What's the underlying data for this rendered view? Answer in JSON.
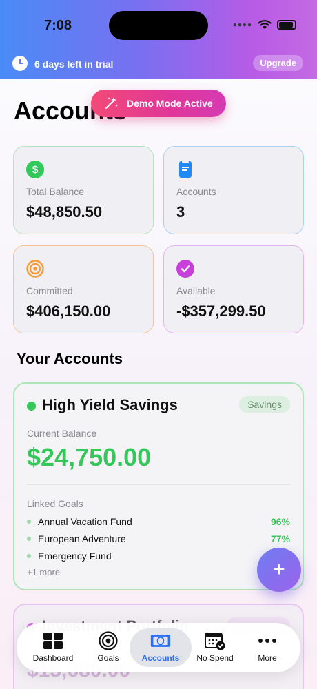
{
  "status_bar": {
    "time": "7:08"
  },
  "trial_banner": {
    "text": "6 days left in trial",
    "upgrade_label": "Upgrade"
  },
  "page": {
    "title": "Accounts",
    "demo_label": "Demo Mode Active"
  },
  "stats": [
    {
      "label": "Total Balance",
      "value": "$48,850.50",
      "icon": "dollar-icon",
      "color": "#34c759",
      "border": "#b6e5c0"
    },
    {
      "label": "Accounts",
      "value": "3",
      "icon": "card-icon",
      "color": "#1f8af5",
      "border": "#a7d3f5"
    },
    {
      "label": "Committed",
      "value": "$406,150.00",
      "icon": "target-icon",
      "color": "#f59b3a",
      "border": "#f4c49b"
    },
    {
      "label": "Available",
      "value": "-$357,299.50",
      "icon": "check-icon",
      "color": "#c53fd8",
      "border": "#e3b5ef"
    }
  ],
  "section": {
    "title": "Your Accounts"
  },
  "accounts": [
    {
      "name": "High Yield Savings",
      "type": "Savings",
      "balance_label": "Current Balance",
      "balance": "$24,750.00",
      "linked_goals_label": "Linked Goals",
      "goals": [
        {
          "name": "Annual Vacation Fund",
          "percent": "96%"
        },
        {
          "name": "European Adventure",
          "percent": "77%"
        },
        {
          "name": "Emergency Fund",
          "percent": ""
        }
      ],
      "more": "+1 more"
    },
    {
      "name": "Investment Portfolio",
      "balance": "$15,680.00"
    }
  ],
  "fab": {
    "label": "+"
  },
  "tabs": [
    {
      "label": "Dashboard",
      "icon": "dashboard-icon"
    },
    {
      "label": "Goals",
      "icon": "goals-target-icon"
    },
    {
      "label": "Accounts",
      "icon": "accounts-icon",
      "active": true
    },
    {
      "label": "No Spend",
      "icon": "calendar-check-icon"
    },
    {
      "label": "More",
      "icon": "more-dots-icon"
    }
  ]
}
